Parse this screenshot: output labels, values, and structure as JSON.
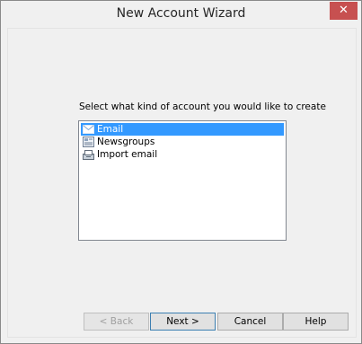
{
  "window": {
    "title": "New Account Wizard",
    "close_icon": "close-icon"
  },
  "main": {
    "prompt": "Select what kind of account you would like to create",
    "account_types": [
      {
        "label": "Email",
        "icon": "mail-icon",
        "selected": true
      },
      {
        "label": "Newsgroups",
        "icon": "newsgroup-icon",
        "selected": false
      },
      {
        "label": "Import email",
        "icon": "import-icon",
        "selected": false
      }
    ]
  },
  "buttons": {
    "back": "< Back",
    "next": "Next >",
    "cancel": "Cancel",
    "help": "Help"
  },
  "colors": {
    "selection": "#3399ff",
    "close_button": "#c75050"
  }
}
